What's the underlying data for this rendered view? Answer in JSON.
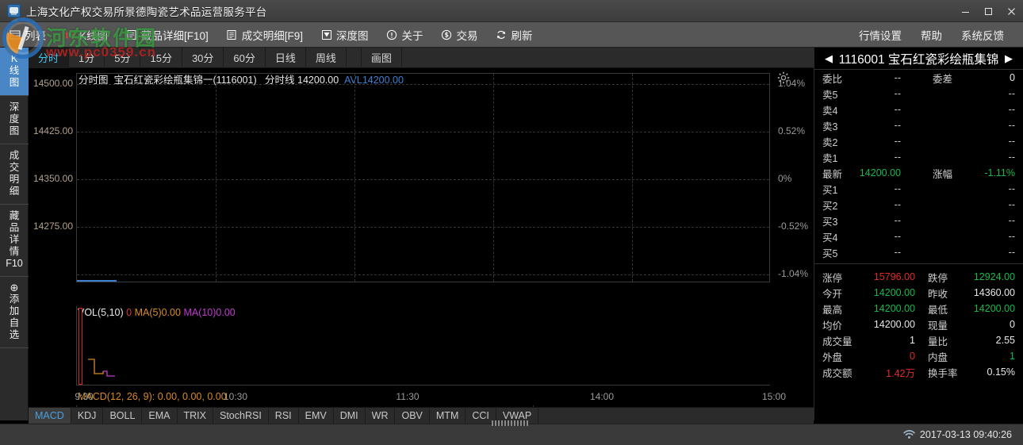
{
  "window": {
    "title": "上海文化产权交易所景德陶瓷艺术品运营服务平台",
    "minimize": "—",
    "maximize": "❐",
    "close": "✕"
  },
  "watermark": {
    "text": "河东软件园",
    "sub": "www.pc0359.cn"
  },
  "toolbar": {
    "left_items": [
      {
        "icon": "list-icon",
        "label": "列表"
      },
      {
        "icon": "kline-icon",
        "label": "K线图"
      },
      {
        "icon": "document-icon",
        "label": "藏品详细[F10]"
      },
      {
        "icon": "ledger-icon",
        "label": "成交明细[F9]"
      },
      {
        "icon": "depth-icon",
        "label": "深度图"
      },
      {
        "icon": "info-icon",
        "label": "关于"
      },
      {
        "icon": "dollar-icon",
        "label": "交易"
      },
      {
        "icon": "refresh-icon",
        "label": "刷新"
      }
    ],
    "right_items": [
      {
        "label": "行情设置"
      },
      {
        "label": "帮助"
      },
      {
        "label": "系统反馈"
      }
    ]
  },
  "sidebar": {
    "items": [
      {
        "label": "K线图",
        "chars": [
          "K",
          "线",
          "图"
        ],
        "active": true
      },
      {
        "label": "深度图",
        "chars": [
          "深",
          "度",
          "图"
        ],
        "active": false
      },
      {
        "label": "成交明细",
        "chars": [
          "成",
          "交",
          "明",
          "细"
        ],
        "active": false
      },
      {
        "label": "藏品详情F10",
        "chars": [
          "藏",
          "品",
          "详",
          "情",
          "F10"
        ],
        "active": false
      },
      {
        "label": "添加自选",
        "chars": [
          "添",
          "加",
          "自",
          "选"
        ],
        "active": false,
        "plus": "⊕"
      }
    ]
  },
  "timeframes": [
    {
      "label": "分时",
      "active": true
    },
    {
      "label": "1分",
      "active": false
    },
    {
      "label": "5分",
      "active": false
    },
    {
      "label": "15分",
      "active": false
    },
    {
      "label": "30分",
      "active": false
    },
    {
      "label": "60分",
      "active": false
    },
    {
      "label": "日线",
      "active": false
    },
    {
      "label": "周线",
      "active": false
    },
    {
      "label": "画图",
      "active": false
    }
  ],
  "chart_header": {
    "type": "分时图",
    "name": "宝石红瓷彩绘瓶集锦一(1116001)",
    "series_label": "分时线",
    "price": "14200.00",
    "avl": "AVL14200.00"
  },
  "chart_data": {
    "type": "line",
    "title": "分时图 宝石红瓷彩绘瓶集锦一(1116001)",
    "xlabel": "",
    "ylabel": "",
    "x": [
      "9:30",
      "10:30",
      "11:30",
      "14:00",
      "15:00"
    ],
    "xtick_labels": [
      "9:30",
      "10:30",
      "11:30",
      "14:00",
      "15:00"
    ],
    "ytick_labels": [
      "14500.00",
      "14425.00",
      "14350.00",
      "14275.00"
    ],
    "ylim": [
      14210,
      14510
    ],
    "right_axis_labels": [
      "1.04%",
      "0.52%",
      "0%",
      "-0.52%",
      "-1.04%"
    ],
    "right_axis_values": [
      1.04,
      0.52,
      0,
      -0.52,
      -1.04
    ],
    "prev_close": 14360.0,
    "series": [
      {
        "name": "分时线",
        "color": "#3f7fd0",
        "values": [
          14200.0
        ]
      },
      {
        "name": "AVL",
        "color": "#3f7fd0",
        "values": [
          14200.0
        ]
      }
    ],
    "grid": true,
    "legend": "top-left",
    "subcharts": [
      {
        "type": "bar",
        "name": "VOL(5,10)",
        "value": "0",
        "ma5": "MA(5)0.00",
        "ma10": "MA(10)0.00",
        "bars": [
          1
        ]
      },
      {
        "type": "line",
        "name": "MACD(12, 26, 9)",
        "values": [
          "0.00",
          "0.00",
          "0.00"
        ]
      }
    ]
  },
  "indicators": [
    {
      "label": "MACD",
      "active": true
    },
    {
      "label": "KDJ",
      "active": false
    },
    {
      "label": "BOLL",
      "active": false
    },
    {
      "label": "EMA",
      "active": false
    },
    {
      "label": "TRIX",
      "active": false
    },
    {
      "label": "StochRSI",
      "active": false
    },
    {
      "label": "RSI",
      "active": false
    },
    {
      "label": "EMV",
      "active": false
    },
    {
      "label": "DMI",
      "active": false
    },
    {
      "label": "WR",
      "active": false
    },
    {
      "label": "OBV",
      "active": false
    },
    {
      "label": "MTM",
      "active": false
    },
    {
      "label": "CCI",
      "active": false
    },
    {
      "label": "VWAP",
      "active": false
    }
  ],
  "quote": {
    "prev_arrow": "◀",
    "next_arrow": "▶",
    "code": "1116001",
    "name": "宝石红瓷彩绘瓶集锦",
    "ratio_row": {
      "label": "委比",
      "value": "--",
      "label2": "委差",
      "value2": "0"
    },
    "asks": [
      {
        "label": "卖5",
        "price": "--",
        "volume": "--"
      },
      {
        "label": "卖4",
        "price": "--",
        "volume": "--"
      },
      {
        "label": "卖3",
        "price": "--",
        "volume": "--"
      },
      {
        "label": "卖2",
        "price": "--",
        "volume": "--"
      },
      {
        "label": "卖1",
        "price": "--",
        "volume": "--"
      }
    ],
    "last": {
      "label": "最新",
      "price": "14200.00",
      "label2": "涨幅",
      "change": "-1.11%"
    },
    "bids": [
      {
        "label": "买1",
        "price": "--",
        "volume": "--"
      },
      {
        "label": "买2",
        "price": "--",
        "volume": "--"
      },
      {
        "label": "买3",
        "price": "--",
        "volume": "--"
      },
      {
        "label": "买4",
        "price": "--",
        "volume": "--"
      },
      {
        "label": "买5",
        "price": "--",
        "volume": "--"
      }
    ],
    "stats": [
      {
        "k": "涨停",
        "v": "15796.00",
        "vc": "red",
        "k2": "跌停",
        "v2": "12924.00",
        "v2c": "green"
      },
      {
        "k": "今开",
        "v": "14200.00",
        "vc": "green",
        "k2": "昨收",
        "v2": "14360.00",
        "v2c": "white"
      },
      {
        "k": "最高",
        "v": "14200.00",
        "vc": "green",
        "k2": "最低",
        "v2": "14200.00",
        "v2c": "green"
      },
      {
        "k": "均价",
        "v": "14200.00",
        "vc": "white",
        "k2": "现量",
        "v2": "0",
        "v2c": "white"
      },
      {
        "k": "成交量",
        "v": "1",
        "vc": "white",
        "k2": "量比",
        "v2": "2.55",
        "v2c": "white"
      },
      {
        "k": "外盘",
        "v": "0",
        "vc": "red",
        "k2": "内盘",
        "v2": "1",
        "v2c": "green"
      },
      {
        "k": "成交额",
        "v": "1.42万",
        "vc": "red",
        "k2": "换手率",
        "v2": "0.15%",
        "v2c": "white"
      }
    ]
  },
  "status": {
    "time": "2017-03-13 09:40:26"
  },
  "colors": {
    "accent": "#4886c6",
    "up": "#e02a2a",
    "down": "#18b84c",
    "line": "#3f7fd0",
    "ma5": "#d88a22",
    "ma10": "#c23ad0"
  }
}
